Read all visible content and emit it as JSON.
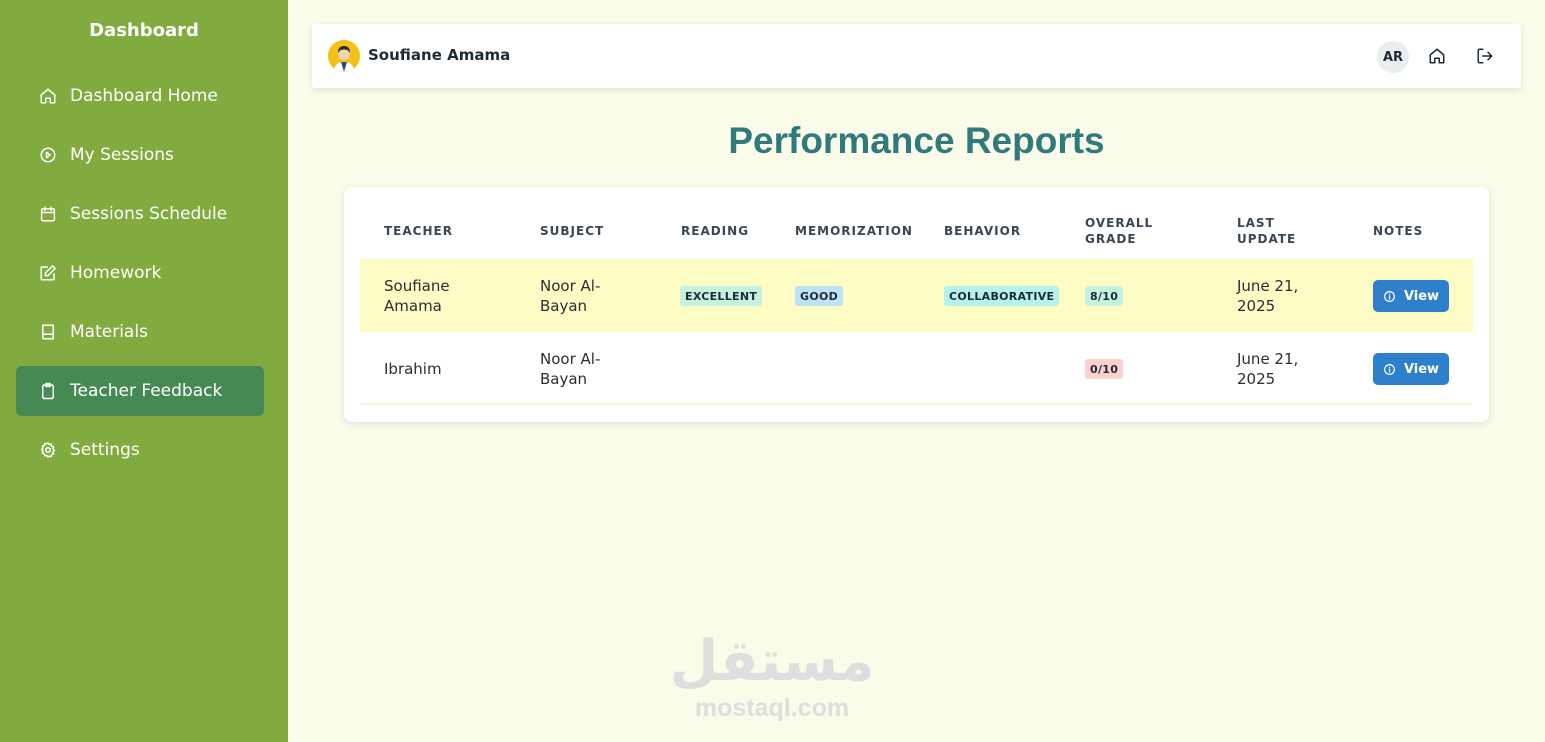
{
  "sidebar": {
    "title": "Dashboard",
    "items": [
      {
        "label": "Dashboard Home",
        "icon": "home-icon",
        "active": false
      },
      {
        "label": "My Sessions",
        "icon": "play-circle-icon",
        "active": false
      },
      {
        "label": "Sessions Schedule",
        "icon": "calendar-icon",
        "active": false
      },
      {
        "label": "Homework",
        "icon": "edit-icon",
        "active": false
      },
      {
        "label": "Materials",
        "icon": "book-icon",
        "active": false
      },
      {
        "label": "Teacher Feedback",
        "icon": "clipboard-icon",
        "active": true
      },
      {
        "label": "Settings",
        "icon": "gear-icon",
        "active": false
      }
    ]
  },
  "header": {
    "user_name": "Soufiane Amama",
    "language": "AR",
    "icons": [
      "home-icon",
      "logout-icon"
    ]
  },
  "page": {
    "title": "Performance Reports"
  },
  "table": {
    "columns": [
      "TEACHER",
      "SUBJECT",
      "READING",
      "MEMORIZATION",
      "BEHAVIOR",
      "OVERALL GRADE",
      "LAST UPDATE",
      "NOTES"
    ],
    "rows": [
      {
        "teacher": "Soufiane Amama",
        "subject": "Noor Al-Bayan",
        "reading": "EXCELLENT",
        "memorization": "GOOD",
        "behavior": "COLLABORATIVE",
        "grade": "8/10",
        "last_update": "June 21, 2025",
        "notes_label": "View"
      },
      {
        "teacher": "Ibrahim",
        "subject": "Noor Al-Bayan",
        "reading": "",
        "memorization": "",
        "behavior": "",
        "grade": "0/10",
        "last_update": "June 21, 2025",
        "notes_label": "View"
      }
    ]
  },
  "colors": {
    "sidebar_bg": "#82ab3f",
    "sidebar_active": "#458a55",
    "title": "#2f7a7a",
    "highlight_row": "#fcfcc4",
    "button": "#2f80cc",
    "badge_excellent": "#c6f1dd",
    "badge_good": "#bee3f6",
    "badge_collaborative": "#b6f2ec",
    "badge_grade_good": "#c6f1dd",
    "badge_grade_bad": "#fbd0cd"
  },
  "watermark": {
    "arabic": "مستقل",
    "latin": "mostaql.com"
  }
}
